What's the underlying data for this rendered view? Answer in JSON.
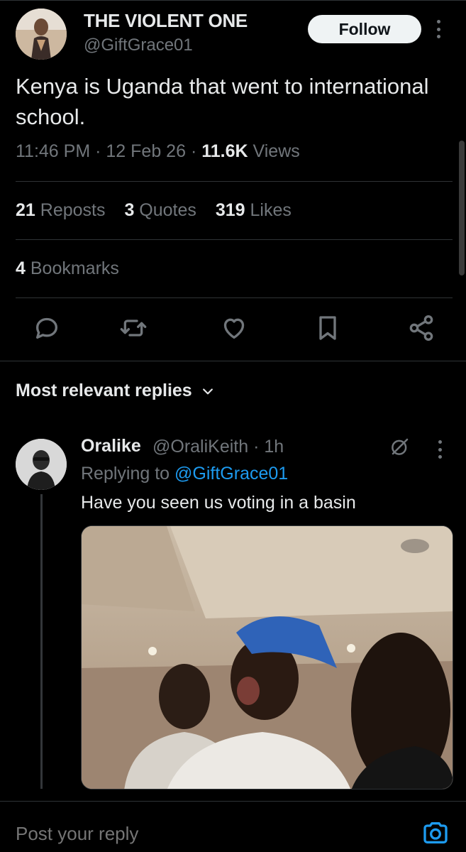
{
  "tweet": {
    "author_name": "THE VIOLENT ONE",
    "author_handle": "@GiftGrace01",
    "follow_label": "Follow",
    "text": "Kenya is Uganda that went to international school.",
    "time": "11:46 PM",
    "date": "12 Feb 26",
    "views_count": "11.6K",
    "views_label": "Views",
    "stats": [
      {
        "count": "21",
        "label": "Reposts"
      },
      {
        "count": "3",
        "label": "Quotes"
      },
      {
        "count": "319",
        "label": "Likes"
      }
    ],
    "bookmarks": {
      "count": "4",
      "label": "Bookmarks"
    }
  },
  "actions": [
    "reply-icon",
    "repost-icon",
    "like-icon",
    "bookmark-icon",
    "share-icon"
  ],
  "replies_sort": "Most relevant replies",
  "reply": {
    "name": "Oralike",
    "handle": "@OraliKeith",
    "age": "1h",
    "replying_prefix": "Replying to",
    "replying_to": "@GiftGrace01",
    "text": "Have you seen us voting in a basin"
  },
  "compose": {
    "placeholder": "Post your reply"
  },
  "colors": {
    "background": "#000000",
    "text": "#e7e9ea",
    "secondary": "#71767b",
    "link": "#1d9bf0",
    "divider": "#2f3336"
  }
}
